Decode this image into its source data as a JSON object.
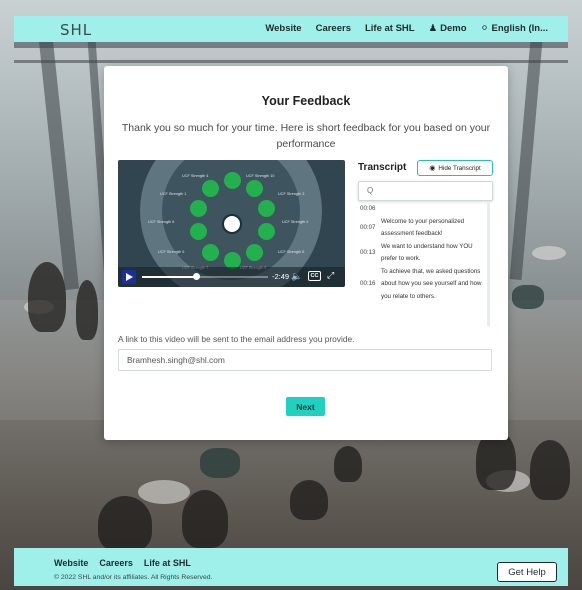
{
  "header": {
    "logo": "SHL",
    "nav": {
      "website": "Website",
      "careers": "Careers",
      "life": "Life at SHL",
      "demo": "Demo",
      "language": "English (In..."
    }
  },
  "feedback": {
    "title": "Your Feedback",
    "subtitle": "Thank you so much for your time. Here is short feedback for you based on your performance"
  },
  "video": {
    "time": "-2:49",
    "progress": 0.43,
    "labels": {
      "s1": "UCF Strength 1",
      "s2": "UCF Strength 2",
      "s3": "UCF Strength 3",
      "s4": "UCF Strength 4",
      "s5": "UCF Strength 5",
      "s6": "UCF Strength 6",
      "s7": "UCF Strength 7",
      "s8": "UCF Strength 8",
      "s9": "UCF Strength 9",
      "s10": "UCF Strength 10"
    },
    "cc": "CC"
  },
  "transcript": {
    "title": "Transcript",
    "hide_label": "Hide Transcript",
    "search_icon": "Q",
    "rows": [
      {
        "time": "00:06",
        "text": ""
      },
      {
        "time": "00:07",
        "text": "Welcome to your personalized assessment feedback!"
      },
      {
        "time": "00:13",
        "text": "We want to understand how YOU prefer to work."
      },
      {
        "time": "00:16",
        "text": "To achieve that, we asked questions about how you see yourself and how you relate to others."
      }
    ]
  },
  "email": {
    "note": "A link to this video will be sent to the email address you provide.",
    "value": "Bramhesh.singh@shl.com"
  },
  "next_label": "Next",
  "footer": {
    "website": "Website",
    "careers": "Careers",
    "life": "Life at SHL",
    "copyright": "© 2022 SHL and/or its affiliates. All Rights Reserved.",
    "help": "Get Help"
  }
}
